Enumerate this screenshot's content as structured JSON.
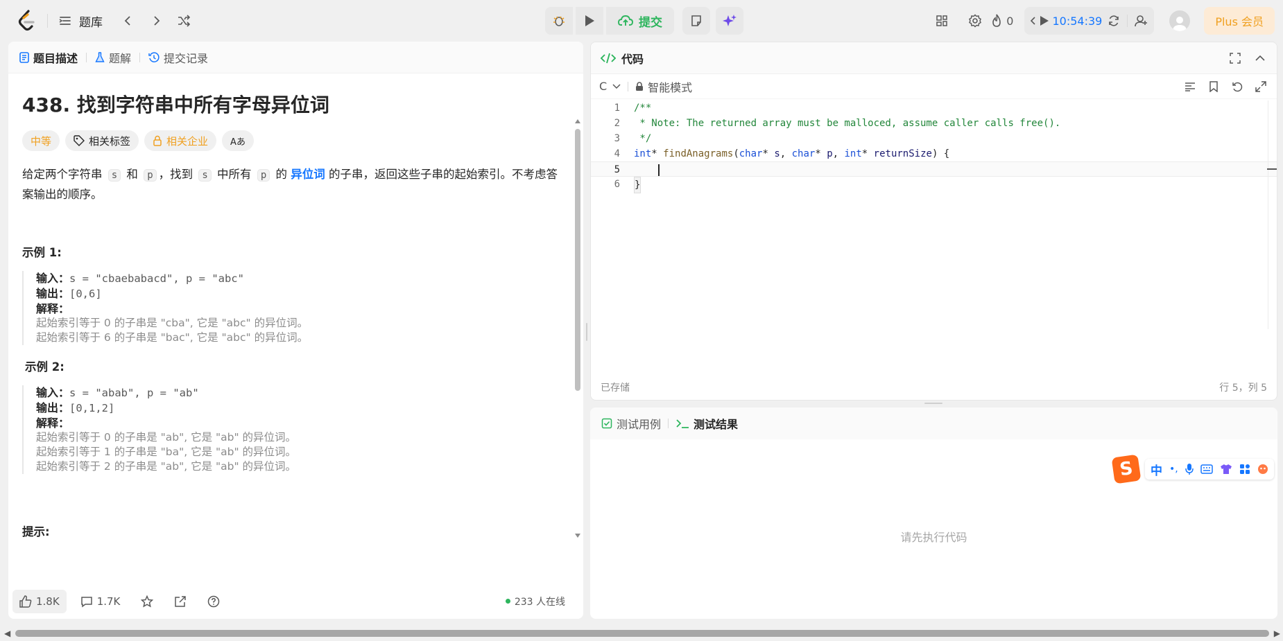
{
  "nav": {
    "problem_bank": "题库",
    "submit": "提交",
    "streak_count": "0",
    "timer": "10:54:39",
    "plus": "Plus 会员"
  },
  "left": {
    "tabs": [
      "题目描述",
      "题解",
      "提交记录"
    ],
    "title": "438. 找到字符串中所有字母异位词",
    "chips": {
      "difficulty": "中等",
      "tags": "相关标签",
      "companies": "相关企业",
      "translate": "Aあ"
    },
    "desc": {
      "p1": "给定两个字符串 ",
      "s": "s",
      "and": " 和 ",
      "p": "p",
      "p2": "，找到 ",
      "p3": " 中所有 ",
      "p4": " 的 ",
      "anagram": "异位词",
      "p5": " 的子串，返回这些子串的起始索引。不考虑答案输出的顺序。"
    },
    "ex1": {
      "title": "示例 1:",
      "input_label": "输入：",
      "input": "s = \"cbaebabacd\", p = \"abc\"",
      "output_label": "输出：",
      "output": "[0,6]",
      "explain_label": "解释：",
      "lines": [
        "起始索引等于 0 的子串是 \"cba\", 它是 \"abc\" 的异位词。",
        "起始索引等于 6 的子串是 \"bac\", 它是 \"abc\" 的异位词。"
      ]
    },
    "ex2": {
      "title": "示例 2:",
      "input_label": "输入：",
      "input": "s = \"abab\", p = \"ab\"",
      "output_label": "输出：",
      "output": "[0,1,2]",
      "explain_label": "解释：",
      "lines": [
        "起始索引等于 0 的子串是 \"ab\", 它是 \"ab\" 的异位词。",
        "起始索引等于 1 的子串是 \"ba\", 它是 \"ab\" 的异位词。",
        "起始索引等于 2 的子串是 \"ab\", 它是 \"ab\" 的异位词。"
      ]
    },
    "hint_title": "提示:",
    "footer": {
      "likes": "1.8K",
      "comments": "1.7K",
      "online": "233 人在线"
    }
  },
  "code": {
    "tab": "代码",
    "lang": "C",
    "mode": "智能模式",
    "lines": [
      "/**",
      " * Note: The returned array must be malloced, assume caller calls free().",
      " */",
      "int* findAnagrams(char* s, char* p, int* returnSize) {",
      "    ",
      "}"
    ],
    "saved": "已存储",
    "position": "行 5，列 5"
  },
  "result": {
    "tabs": [
      "测试用例",
      "测试结果"
    ],
    "placeholder": "请先执行代码"
  },
  "ime": {
    "lang": "中",
    "punct": "•,"
  }
}
